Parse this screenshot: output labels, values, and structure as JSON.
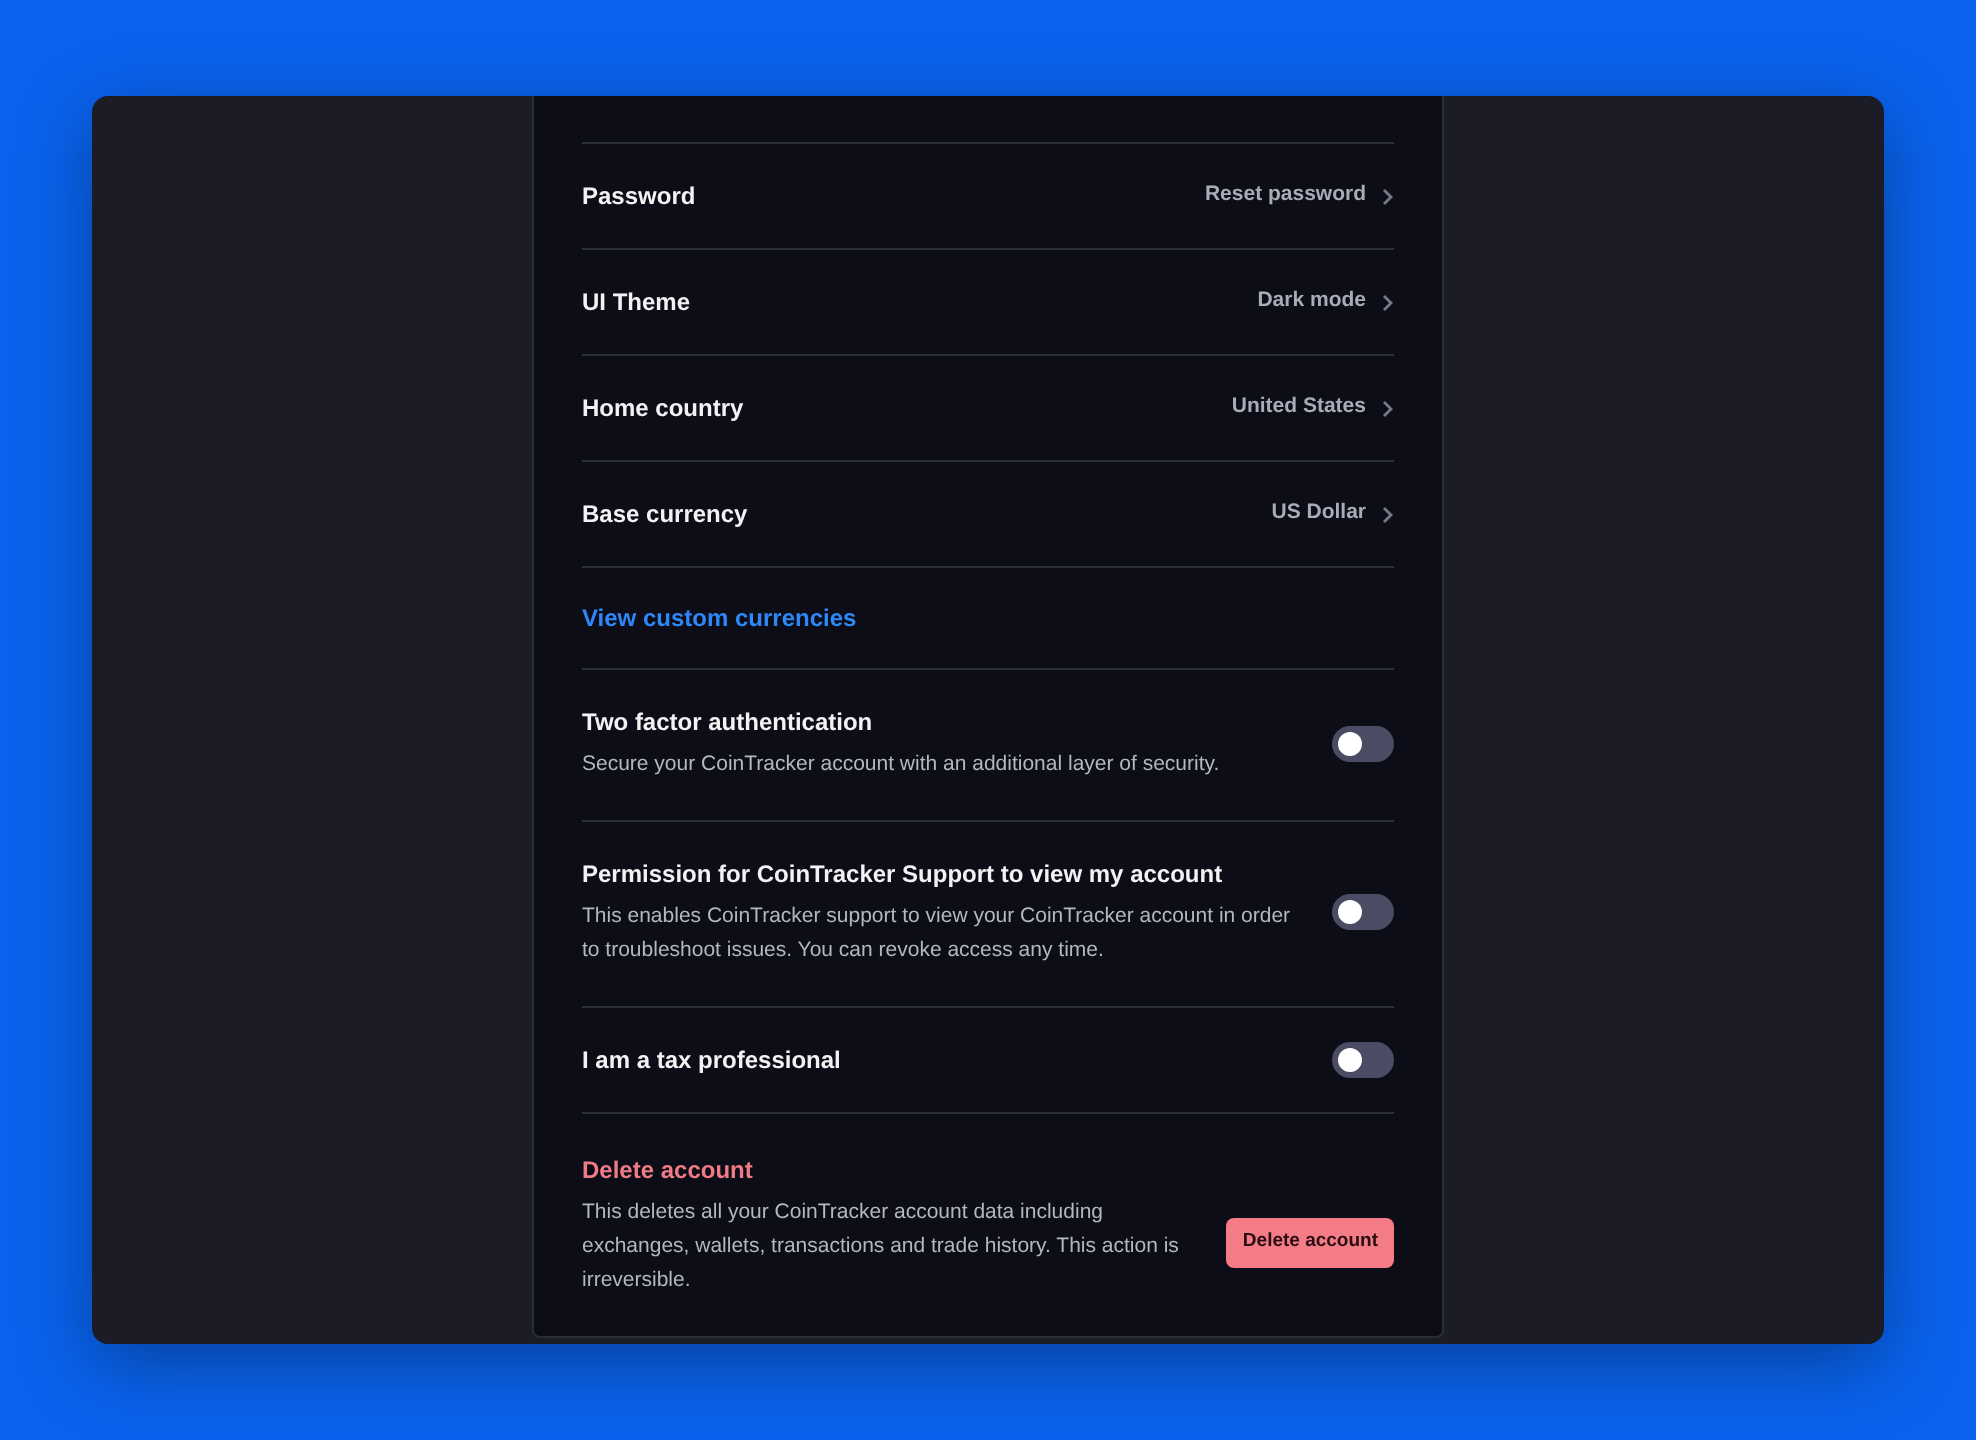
{
  "nav_rows": [
    {
      "label": "Password",
      "value": "Reset password"
    },
    {
      "label": "UI Theme",
      "value": "Dark mode"
    },
    {
      "label": "Home country",
      "value": "United States"
    },
    {
      "label": "Base currency",
      "value": "US Dollar"
    }
  ],
  "link": "View custom currencies",
  "toggles": [
    {
      "title": "Two factor authentication",
      "description": "Secure your CoinTracker account with an additional layer of security.",
      "on": false
    },
    {
      "title": "Permission for CoinTracker Support to view my account",
      "description": "This enables CoinTracker support to view your CoinTracker account in order to troubleshoot issues. You can revoke access any time.",
      "on": false
    },
    {
      "title": "I am a tax professional",
      "on": false
    }
  ],
  "delete": {
    "title": "Delete account",
    "description": "This deletes all your CoinTracker account data including exchanges, wallets, transactions and trade history. This action is irreversible.",
    "button": "Delete account"
  }
}
